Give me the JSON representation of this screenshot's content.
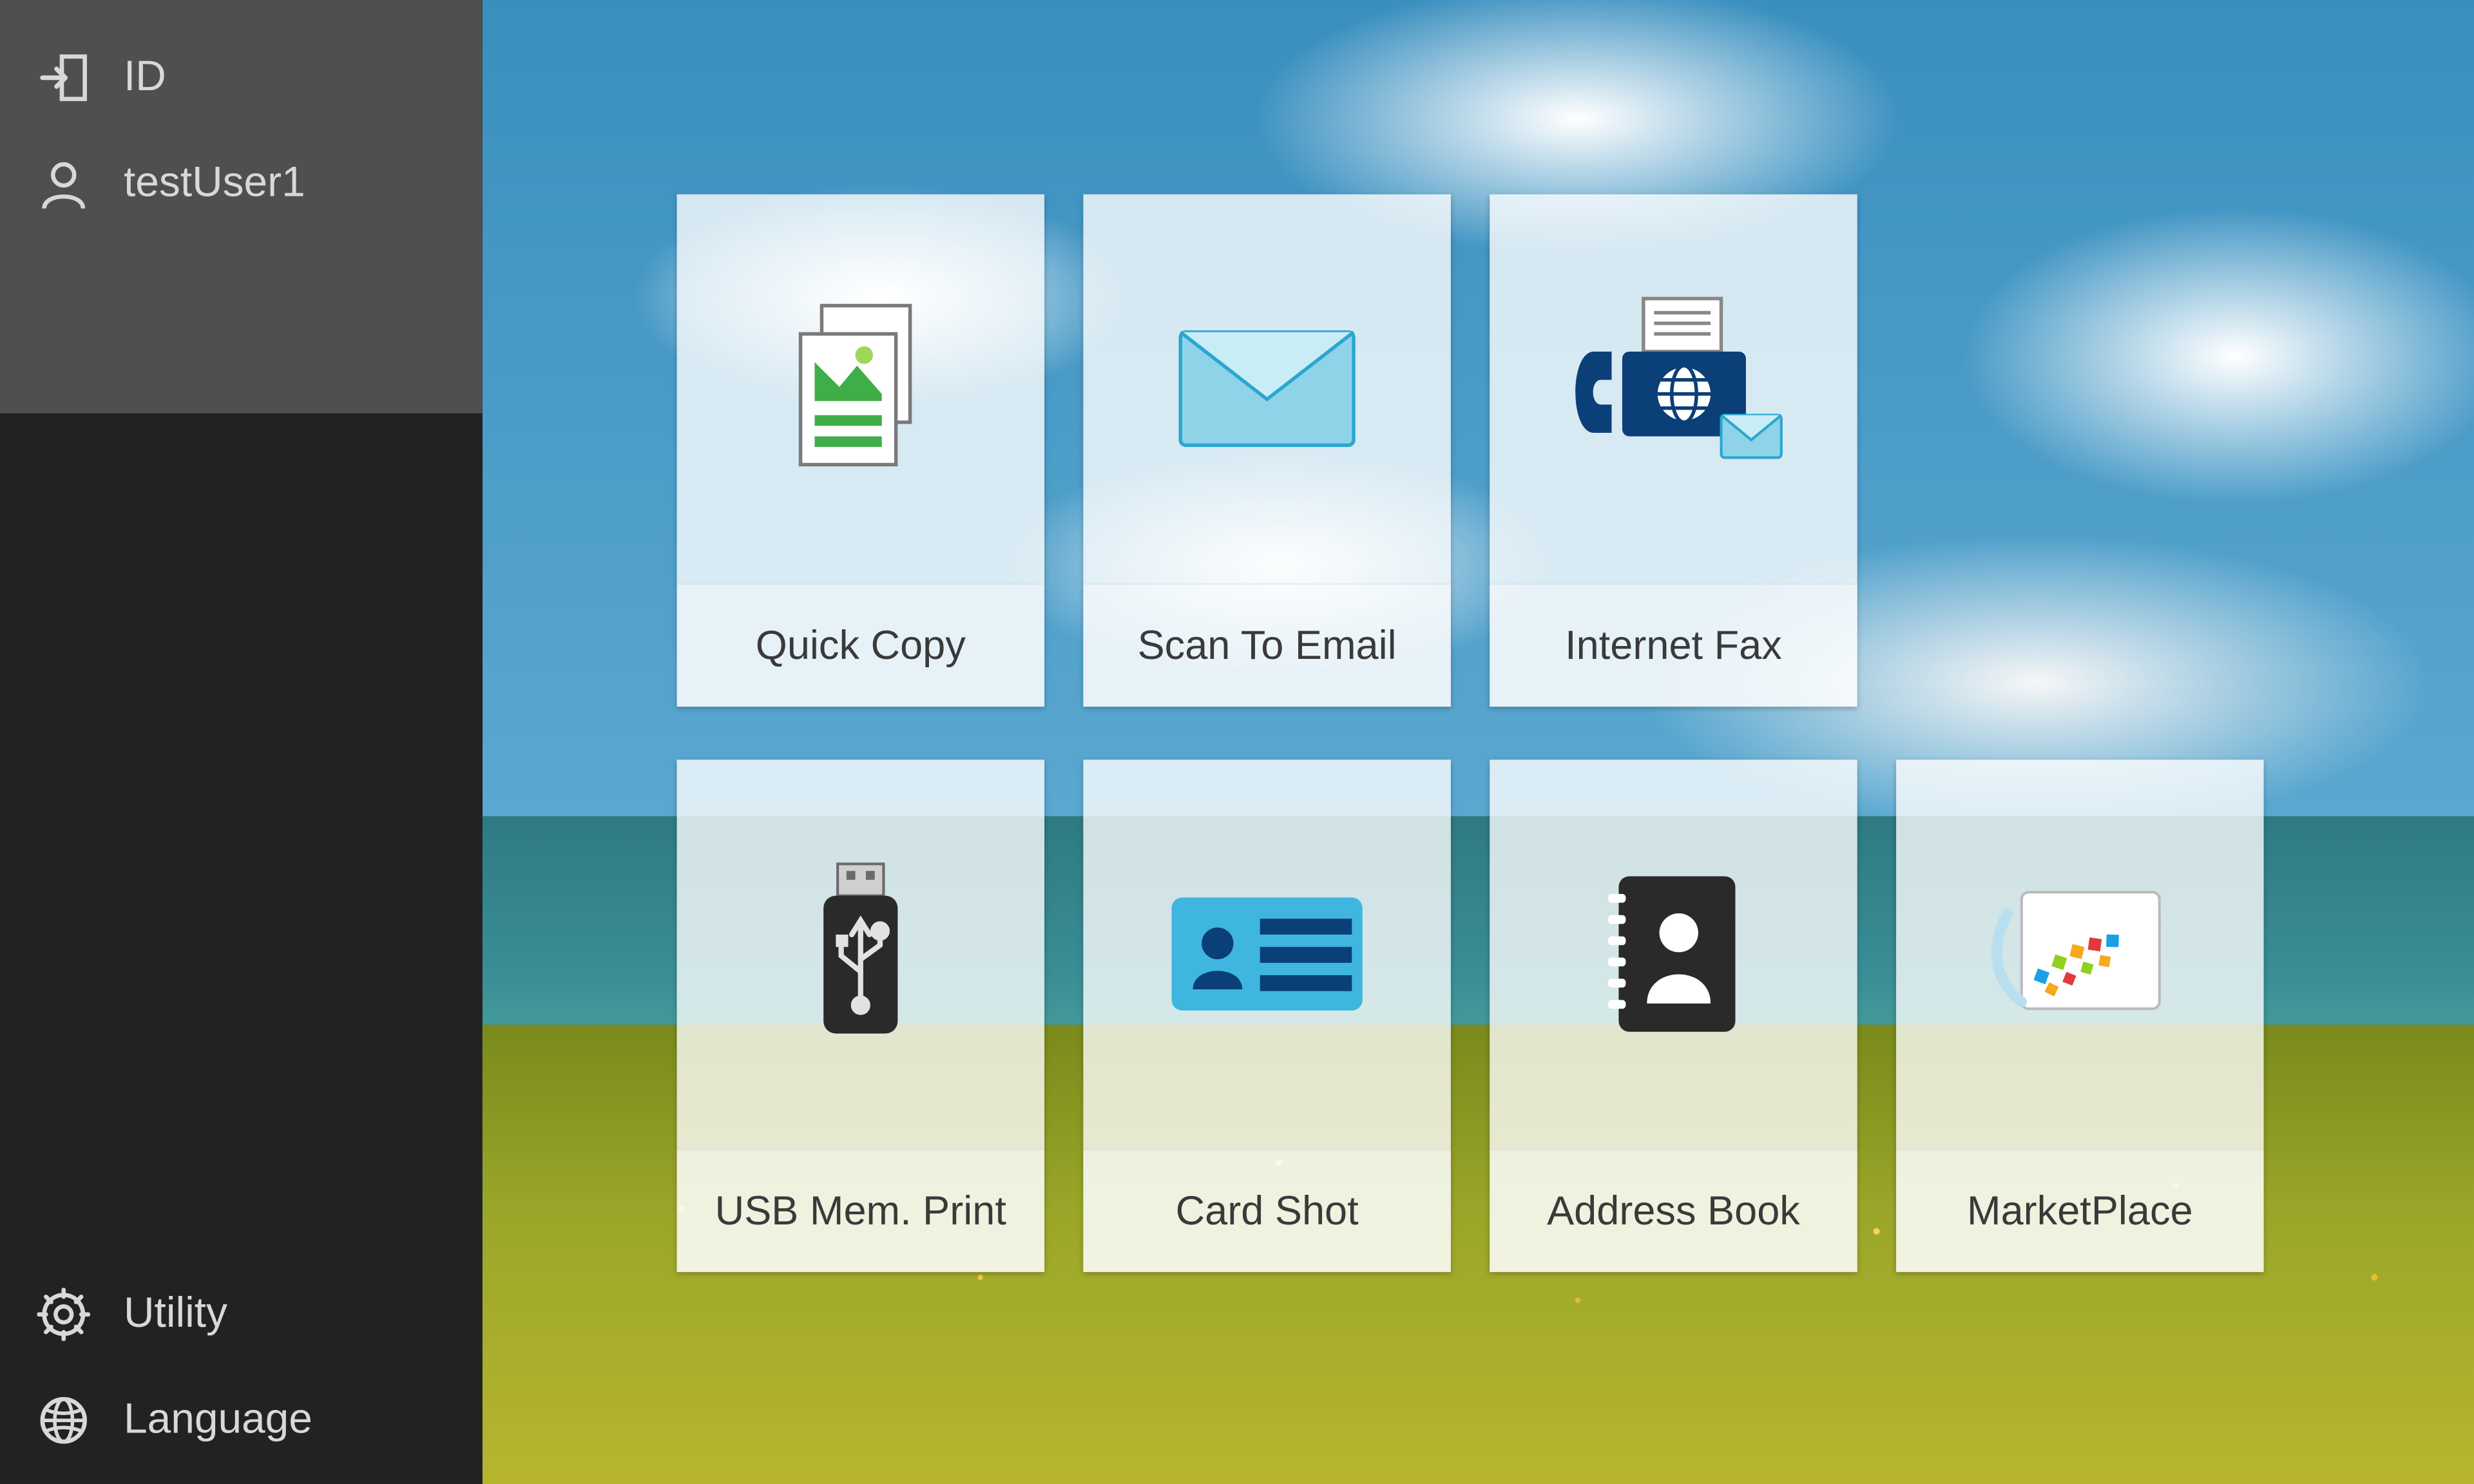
{
  "sidebar": {
    "id_label": "ID",
    "username": "testUser1",
    "utility_label": "Utility",
    "language_label": "Language"
  },
  "tiles": {
    "quick_copy": {
      "label": "Quick Copy",
      "icon": "quick-copy-icon"
    },
    "scan_to_email": {
      "label": "Scan To Email",
      "icon": "envelope-icon"
    },
    "internet_fax": {
      "label": "Internet Fax",
      "icon": "internet-fax-icon"
    },
    "usb_mem_print": {
      "label": "USB Mem. Print",
      "icon": "usb-drive-icon"
    },
    "card_shot": {
      "label": "Card Shot",
      "icon": "id-card-icon"
    },
    "address_book": {
      "label": "Address Book",
      "icon": "address-book-icon"
    },
    "marketplace": {
      "label": "MarketPlace",
      "icon": "marketplace-icon"
    }
  }
}
